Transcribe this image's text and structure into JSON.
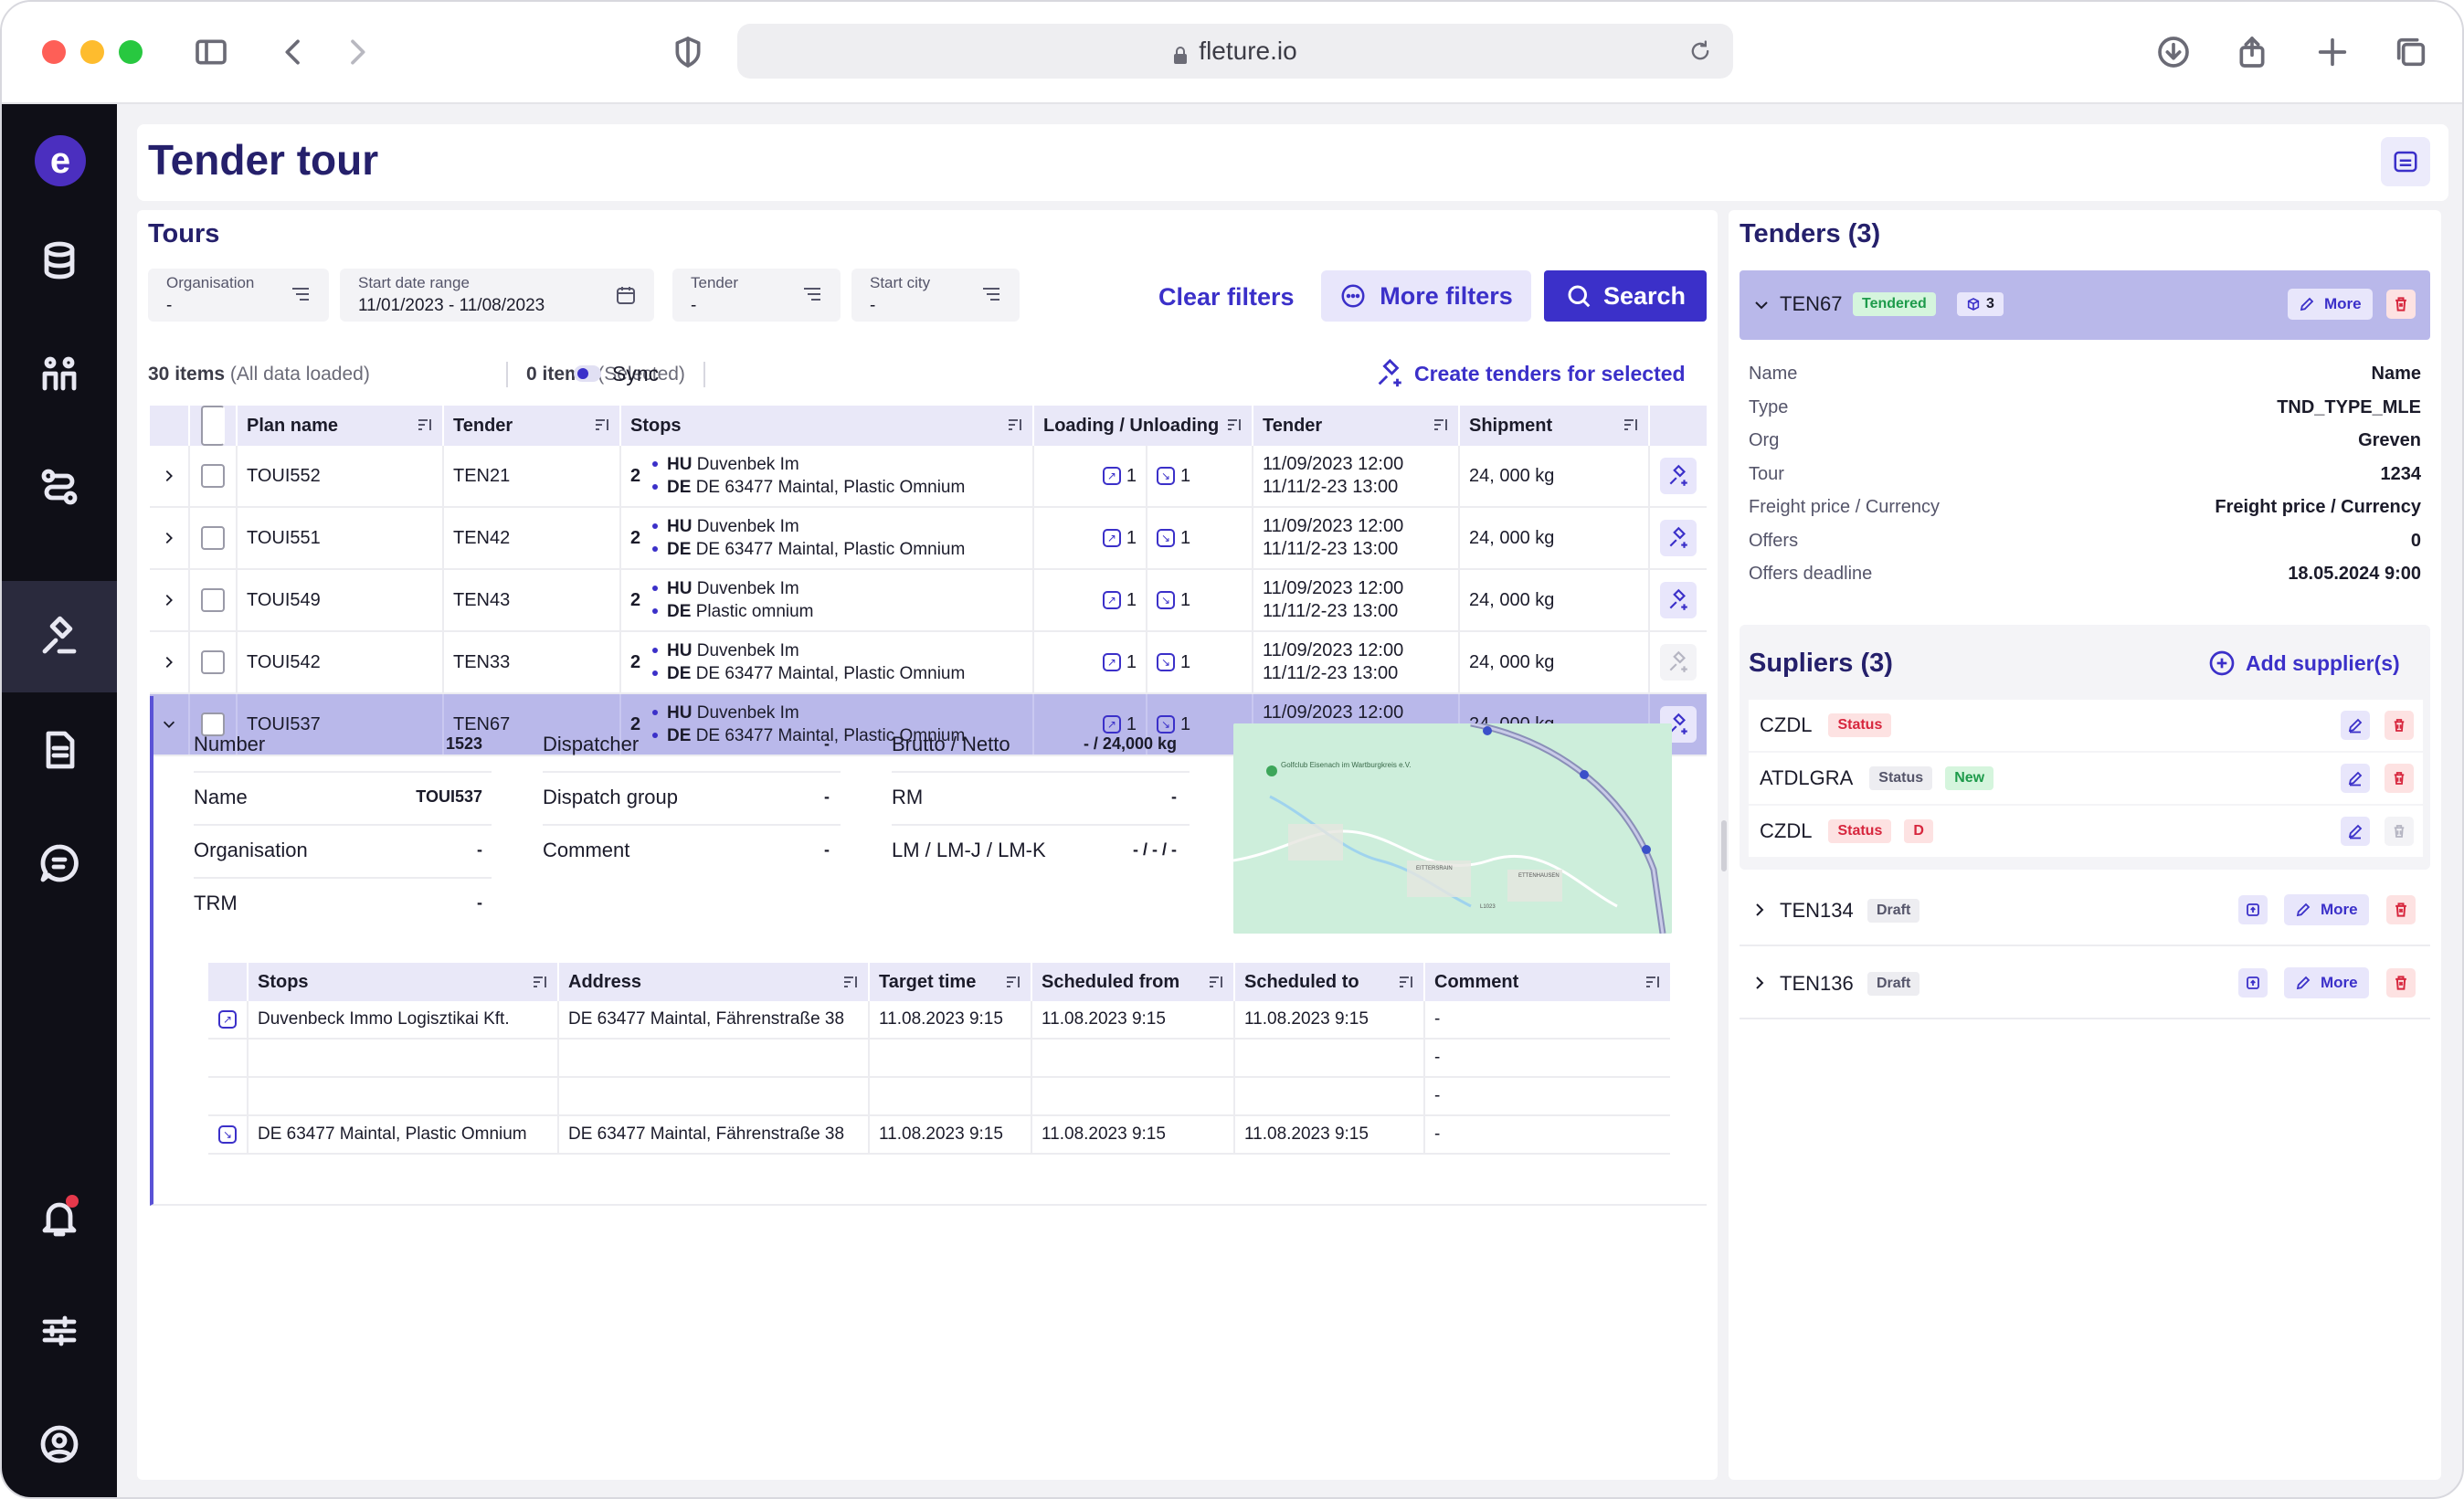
{
  "browser": {
    "url": "fleture.io"
  },
  "page": {
    "title": "Tender tour"
  },
  "tours": {
    "title": "Tours",
    "filters": [
      {
        "label": "Organisation",
        "value": "-"
      },
      {
        "label": "Start date range",
        "value": "11/01/2023 - 11/08/2023"
      },
      {
        "label": "Tender",
        "value": "-"
      },
      {
        "label": "Start city",
        "value": "-"
      }
    ],
    "clear_filters": "Clear filters",
    "more_filters": "More filters",
    "search": "Search",
    "items_count": "30 items",
    "items_note": "(All data loaded)",
    "selected_count": "0 items",
    "selected_note": "(Selected)",
    "sync": "Sync",
    "create_tenders": "Create tenders for selected",
    "columns": [
      "Plan name",
      "Tender",
      "Stops",
      "Loading / Unloading",
      "Tender",
      "Shipment"
    ],
    "rows": [
      {
        "plan": "TOUI552",
        "tender": "TEN21",
        "stop_count": "2",
        "stop1_code": "HU",
        "stop1": "Duvenbek Im",
        "stop2_code": "DE",
        "stop2": "DE 63477 Maintal, Plastic Omnium",
        "load": "1",
        "unload": "1",
        "t1": "11/09/2023 12:00",
        "t2": "11/11/2-23 13:00",
        "shipment": "24, 000 kg"
      },
      {
        "plan": "TOUI551",
        "tender": "TEN42",
        "stop_count": "2",
        "stop1_code": "HU",
        "stop1": "Duvenbek Im",
        "stop2_code": "DE",
        "stop2": "DE 63477 Maintal, Plastic Omnium",
        "load": "1",
        "unload": "1",
        "t1": "11/09/2023 12:00",
        "t2": "11/11/2-23 13:00",
        "shipment": "24, 000 kg"
      },
      {
        "plan": "TOUI549",
        "tender": "TEN43",
        "stop_count": "2",
        "stop1_code": "HU",
        "stop1": "Duvenbek Im",
        "stop2_code": "DE",
        "stop2": "Plastic omnium",
        "load": "1",
        "unload": "1",
        "t1": "11/09/2023 12:00",
        "t2": "11/11/2-23 13:00",
        "shipment": "24, 000 kg"
      },
      {
        "plan": "TOUI542",
        "tender": "TEN33",
        "stop_count": "2",
        "stop1_code": "HU",
        "stop1": "Duvenbek Im",
        "stop2_code": "DE",
        "stop2": "DE 63477 Maintal, Plastic Omnium",
        "load": "1",
        "unload": "1",
        "t1": "11/09/2023 12:00",
        "t2": "11/11/2-23 13:00",
        "shipment": "24, 000 kg"
      },
      {
        "plan": "TOUI537",
        "tender": "TEN67",
        "stop_count": "2",
        "stop1_code": "HU",
        "stop1": "Duvenbek Im",
        "stop2_code": "DE",
        "stop2": "DE 63477 Maintal, Plastic Omnium",
        "load": "1",
        "unload": "1",
        "t1": "11/09/2023 12:00",
        "t2": "11/11/2-23 13:00",
        "shipment": "24, 000 kg"
      }
    ],
    "detail": {
      "number_label": "Number",
      "number": "1523",
      "name_label": "Name",
      "name": "TOUI537",
      "org_label": "Organisation",
      "org": "-",
      "trm_label": "TRM",
      "trm": "-",
      "dispatcher_label": "Dispatcher",
      "dispatcher": "-",
      "dgroup_label": "Dispatch group",
      "dgroup": "-",
      "comment_label": "Comment",
      "comment": "-",
      "brutto_label": "Brutto / Netto",
      "brutto": "- / 24,000 kg",
      "rm_label": "RM",
      "rm": "-",
      "lm_label": "LM / LM-J / LM-K",
      "lm": "- / - / -",
      "map_labels": [
        "Golfclub Eisenach im Wartburgkreis e.V.",
        "EITTERSRAIN",
        "ETTENHAUSEN",
        "L1023"
      ],
      "stop_columns": [
        "Stops",
        "Address",
        "Target time",
        "Scheduled from",
        "Scheduled to",
        "Comment"
      ],
      "stops": [
        {
          "stop": "Duvenbeck Immo Logisztikai Kft.",
          "address": "DE 63477 Maintal, Fährenstraße 38",
          "target": "11.08.2023 9:15",
          "from": "11.08.2023 9:15",
          "to": "11.08.2023 9:15",
          "comment": "-"
        },
        {
          "stop": "",
          "address": "",
          "target": "",
          "from": "",
          "to": "",
          "comment": "-"
        },
        {
          "stop": "",
          "address": "",
          "target": "",
          "from": "",
          "to": "",
          "comment": "-"
        },
        {
          "stop": "DE 63477 Maintal, Plastic Omnium",
          "address": "DE 63477 Maintal, Fährenstraße 38",
          "target": "11.08.2023 9:15",
          "from": "11.08.2023 9:15",
          "to": "11.08.2023 9:15",
          "comment": "-"
        }
      ]
    }
  },
  "tenders": {
    "title": "Tenders (3)",
    "active": {
      "id": "TEN67",
      "status": "Tendered",
      "count": "3",
      "more": "More",
      "fields": [
        {
          "label": "Name",
          "value": "Name"
        },
        {
          "label": "Type",
          "value": "TND_TYPE_MLE"
        },
        {
          "label": "Org",
          "value": "Greven"
        },
        {
          "label": "Tour",
          "value": "1234"
        },
        {
          "label": "Freight price / Currency",
          "value": "Freight price / Currency"
        },
        {
          "label": "Offers",
          "value": "0"
        },
        {
          "label": "Offers deadline",
          "value": "18.05.2024 9:00"
        }
      ]
    },
    "suppliers_title": "Supliers (3)",
    "add_supplier": "Add supplier(s)",
    "suppliers": [
      {
        "name": "CZDL",
        "status": "Status",
        "extra": ""
      },
      {
        "name": "ATDLGRA",
        "status": "Status",
        "extra": "New"
      },
      {
        "name": "CZDL",
        "status": "Status",
        "extra": "D"
      }
    ],
    "others": [
      {
        "id": "TEN134",
        "status": "Draft",
        "more": "More"
      },
      {
        "id": "TEN136",
        "status": "Draft",
        "more": "More"
      }
    ]
  }
}
